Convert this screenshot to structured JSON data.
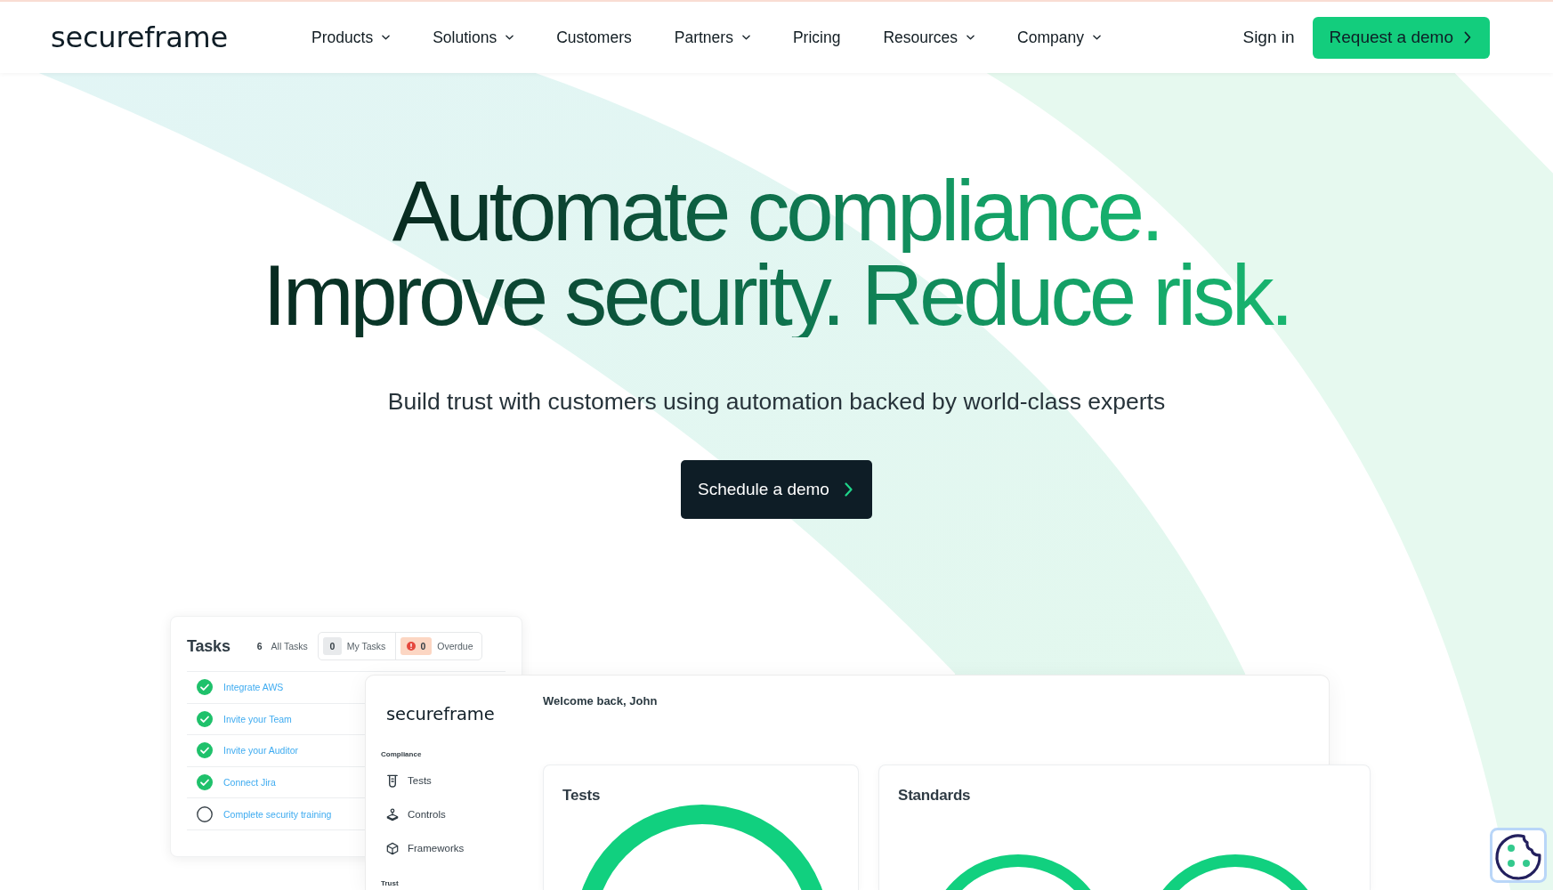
{
  "nav": {
    "logo": "secureframe",
    "links": [
      {
        "label": "Products",
        "has_menu": true
      },
      {
        "label": "Solutions",
        "has_menu": true
      },
      {
        "label": "Customers",
        "has_menu": false
      },
      {
        "label": "Partners",
        "has_menu": true
      },
      {
        "label": "Pricing",
        "has_menu": false
      },
      {
        "label": "Resources",
        "has_menu": true
      },
      {
        "label": "Company",
        "has_menu": true
      }
    ],
    "sign_in": "Sign in",
    "cta": "Request a demo"
  },
  "hero": {
    "headline": [
      "Automate compliance.",
      "Improve security. Reduce risk."
    ],
    "subtitle": "Build trust with customers using automation backed by world-class experts",
    "cta": "Schedule a demo"
  },
  "tasks_card": {
    "title": "Tasks",
    "total_count": "6",
    "total_label": "All Tasks",
    "filters": [
      {
        "kind": "plain",
        "count": "0",
        "label": "My Tasks"
      },
      {
        "kind": "alert",
        "count": "0",
        "label": "Overdue"
      }
    ],
    "tasks": [
      {
        "label": "Integrate AWS",
        "done": true
      },
      {
        "label": "Invite your Team",
        "done": true
      },
      {
        "label": "Invite your Auditor",
        "done": true
      },
      {
        "label": "Connect Jira",
        "done": true
      },
      {
        "label": "Complete security training",
        "done": false
      }
    ]
  },
  "dashboard": {
    "logo": "secureframe",
    "sidebar": [
      {
        "heading": "Compliance",
        "items": [
          "Tests",
          "Controls",
          "Frameworks"
        ]
      },
      {
        "heading": "Trust"
      }
    ],
    "welcome": "Welcome back, John",
    "cards": [
      {
        "kind": "single_ring",
        "title": "Tests"
      },
      {
        "kind": "ring_pair",
        "title": "Standards"
      }
    ]
  }
}
